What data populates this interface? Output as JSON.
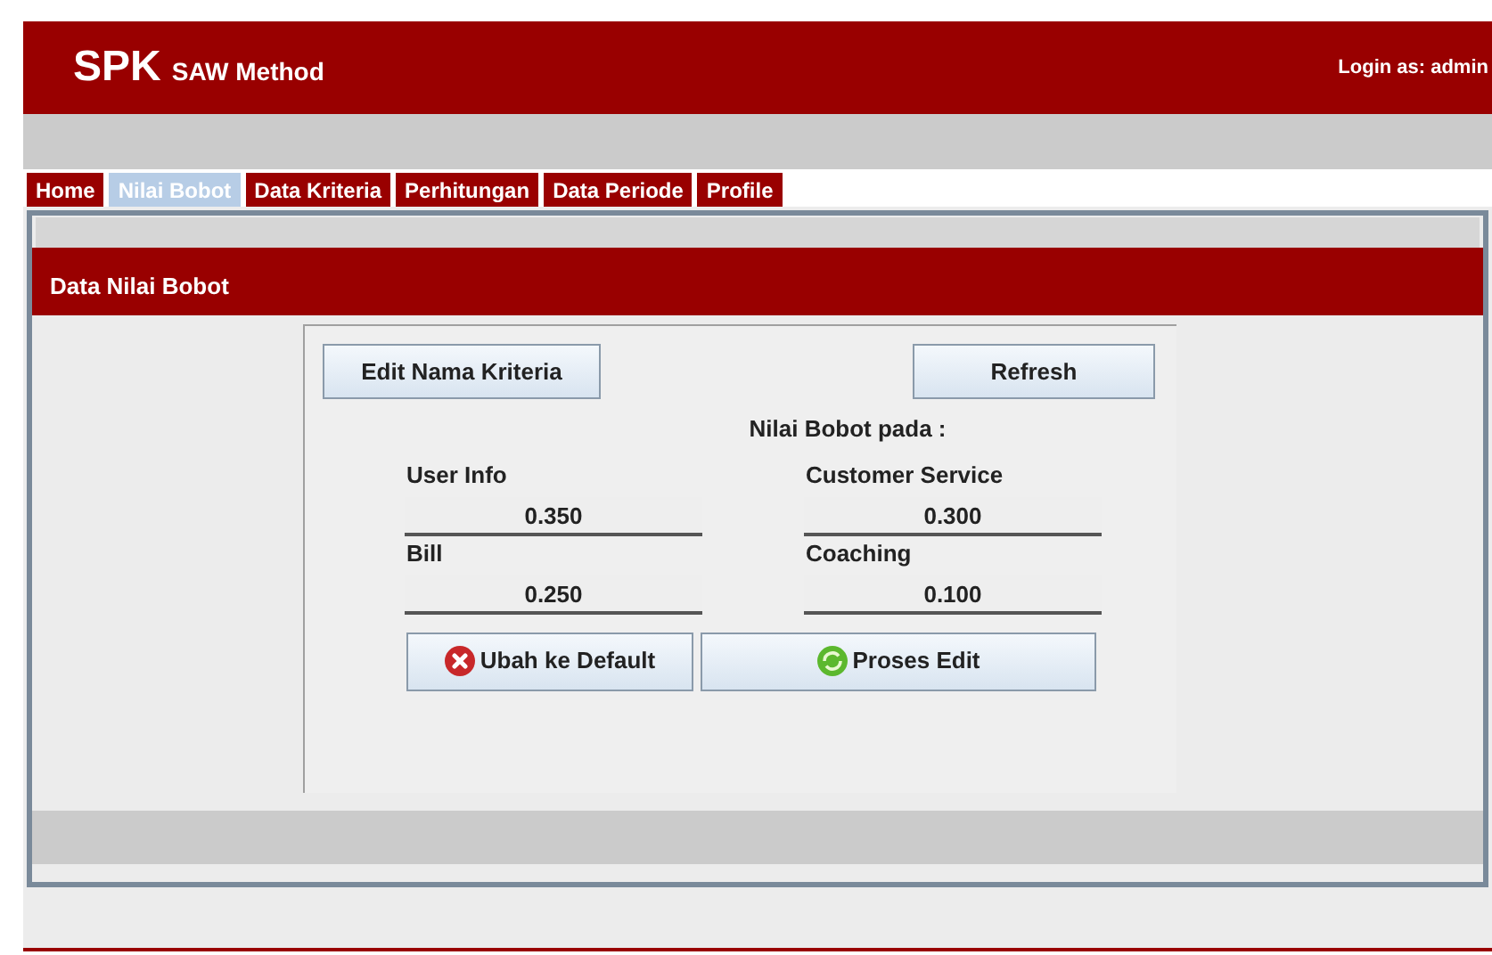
{
  "header": {
    "logo": "SPK",
    "subtitle": "SAW Method",
    "login": "Login as: admin"
  },
  "tabs": [
    {
      "label": "Home",
      "selected": false
    },
    {
      "label": "Nilai Bobot",
      "selected": true
    },
    {
      "label": "Data Kriteria",
      "selected": false
    },
    {
      "label": "Perhitungan",
      "selected": false
    },
    {
      "label": "Data Periode",
      "selected": false
    },
    {
      "label": "Profile",
      "selected": false
    }
  ],
  "panel": {
    "title": "Data Nilai Bobot",
    "top_buttons": [
      "Edit Nama Kriteria",
      "Refresh"
    ],
    "caption": "Nilai Bobot pada :",
    "fields": [
      {
        "label": "User Info",
        "value": "0.350"
      },
      {
        "label": "Customer Service",
        "value": "0.300"
      },
      {
        "label": "Bill",
        "value": "0.250"
      },
      {
        "label": "Coaching",
        "value": "0.100"
      }
    ],
    "actions": [
      {
        "kind": "reset",
        "label": "Ubah ke Default"
      },
      {
        "kind": "process",
        "label": "Proses Edit"
      }
    ]
  }
}
